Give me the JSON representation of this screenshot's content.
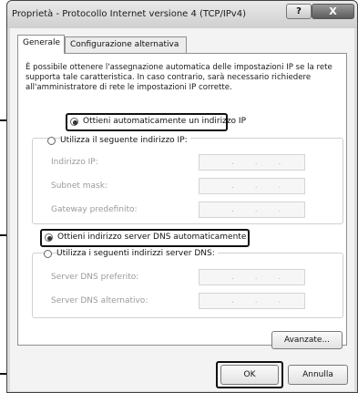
{
  "window": {
    "title": "Proprietà - Protocollo Internet versione 4 (TCP/IPv4)",
    "help_label": "?",
    "close_label": "X"
  },
  "tabs": [
    {
      "label": "Generale",
      "active": true
    },
    {
      "label": "Configurazione alternativa",
      "active": false
    }
  ],
  "description": "È possibile ottenere l'assegnazione automatica delle impostazioni IP se la rete supporta tale caratteristica. In caso contrario, sarà necessario richiedere all'amministratore di rete le impostazioni IP corrette.",
  "ip_section": {
    "auto_label": "Ottieni automaticamente un indirizzo IP",
    "manual_label": "Utilizza il seguente indirizzo IP:",
    "auto_selected": true,
    "fields": [
      {
        "label": "Indirizzo IP:",
        "value": ". . ."
      },
      {
        "label": "Subnet mask:",
        "value": ". . ."
      },
      {
        "label": "Gateway predefinito:",
        "value": ". . ."
      }
    ]
  },
  "dns_section": {
    "auto_label": "Ottieni indirizzo server DNS automaticamente",
    "manual_label": "Utilizza i seguenti indirizzi server DNS:",
    "auto_selected": true,
    "fields": [
      {
        "label": "Server DNS preferito:",
        "value": ". . ."
      },
      {
        "label": "Server DNS alternativo:",
        "value": ". . ."
      }
    ]
  },
  "buttons": {
    "advanced": "Avanzate...",
    "ok": "OK",
    "cancel": "Annulla"
  }
}
